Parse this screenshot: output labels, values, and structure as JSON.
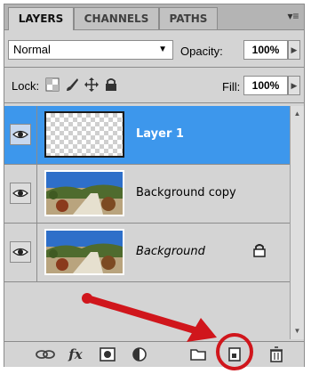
{
  "tabs": [
    {
      "label": "LAYERS",
      "active": true
    },
    {
      "label": "CHANNELS",
      "active": false
    },
    {
      "label": "PATHS",
      "active": false
    }
  ],
  "blend_mode": {
    "value": "Normal"
  },
  "opacity": {
    "label": "Opacity:",
    "value": "100%"
  },
  "lock": {
    "label": "Lock:",
    "icons": [
      "lock-transparent-icon",
      "lock-paint-icon",
      "lock-move-icon",
      "lock-all-icon"
    ]
  },
  "fill": {
    "label": "Fill:",
    "value": "100%"
  },
  "layers": [
    {
      "name": "Layer 1",
      "selected": true,
      "visible": true,
      "thumbnail": "transparent"
    },
    {
      "name": "Background copy",
      "selected": false,
      "visible": true,
      "thumbnail": "photo"
    },
    {
      "name": "Background",
      "selected": false,
      "visible": true,
      "thumbnail": "photo",
      "locked": true,
      "italic": true
    }
  ],
  "toolbar_icons": [
    "link-icon",
    "fx-icon",
    "mask-icon",
    "adjustment-icon",
    "folder-icon",
    "new-layer-icon",
    "trash-icon"
  ],
  "fx_label": "fx",
  "colors": {
    "selection": "#3d97ec",
    "annotation": "#d0161c",
    "panel": "#d4d4d4"
  }
}
